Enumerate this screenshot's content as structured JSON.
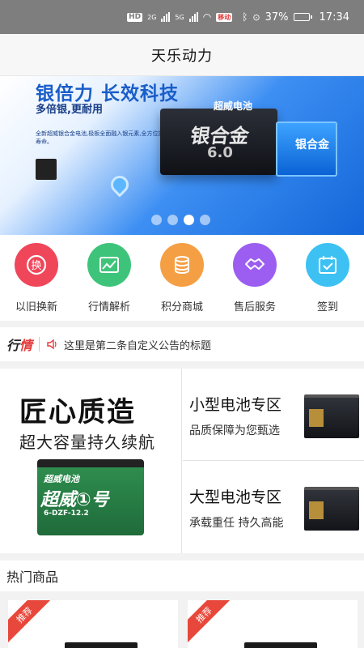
{
  "status_bar": {
    "hd": "HD",
    "net_1": "2G",
    "net_2": "5G",
    "carrier_badge": "移动",
    "battery_percent": "37%",
    "time": "17:34"
  },
  "header": {
    "title": "天乐动力"
  },
  "banner": {
    "headline": "银倍力 长效科技",
    "subline": "多倍银,更耐用",
    "description": "全新超威银合金电池,极板全面融入银元素,全方位提升电池寿命。",
    "product_label": "银合金",
    "product_version": "6.0",
    "product_brand": "超威电池",
    "small_label": "银合金",
    "slide_count": 4,
    "active_slide": 3
  },
  "features": [
    {
      "label": "以旧换新",
      "icon": "exchange-icon",
      "color": "#f0465a"
    },
    {
      "label": "行情解析",
      "icon": "trend-chart-icon",
      "color": "#3ec47a"
    },
    {
      "label": "积分商城",
      "icon": "coins-icon",
      "color": "#f59f44"
    },
    {
      "label": "售后服务",
      "icon": "handshake-icon",
      "color": "#9c5ef0"
    },
    {
      "label": "签到",
      "icon": "calendar-check-icon",
      "color": "#3dc1f2"
    }
  ],
  "notice": {
    "tag_part1": "行",
    "tag_part2": "情",
    "text": "这里是第二条自定义公告的标题"
  },
  "promo": {
    "left_title": "匠心质造",
    "left_subtitle": "超大容量持久续航",
    "battery_brand": "超威电池",
    "battery_name": "超威①号",
    "battery_code": "6-DZF-12.2",
    "cells": [
      {
        "title": "小型电池专区",
        "subtitle": "品质保障为您甄选"
      },
      {
        "title": "大型电池专区",
        "subtitle": "承载重任 持久高能"
      }
    ]
  },
  "hot": {
    "title": "热门商品",
    "products": [
      {
        "tag": "推荐"
      },
      {
        "tag": "推荐"
      }
    ]
  }
}
